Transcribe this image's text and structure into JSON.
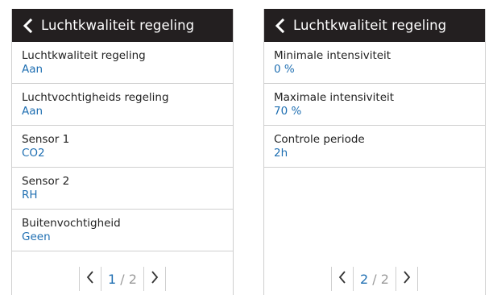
{
  "screens": [
    {
      "title": "Luchtkwaliteit regeling",
      "items": [
        {
          "label": "Luchtkwaliteit regeling",
          "value": "Aan"
        },
        {
          "label": "Luchtvochtigheids regeling",
          "value": "Aan"
        },
        {
          "label": "Sensor 1",
          "value": "CO2"
        },
        {
          "label": "Sensor 2",
          "value": "RH"
        },
        {
          "label": "Buitenvochtigheid",
          "value": "Geen"
        }
      ],
      "pager": {
        "current": "1",
        "separator": "/",
        "total": "2"
      }
    },
    {
      "title": "Luchtkwaliteit regeling",
      "items": [
        {
          "label": "Minimale intensiviteit",
          "value": "0 %"
        },
        {
          "label": "Maximale intensiviteit",
          "value": "70 %"
        },
        {
          "label": "Controle periode",
          "value": "2h"
        }
      ],
      "pager": {
        "current": "2",
        "separator": "/",
        "total": "2"
      }
    }
  ],
  "icons": {
    "back": "chevron-left-icon",
    "prev": "chevron-left-icon",
    "next": "chevron-right-icon"
  },
  "colors": {
    "header_bg": "#231f20",
    "value_text": "#1f6fb2",
    "divider": "#cfcfcf"
  }
}
